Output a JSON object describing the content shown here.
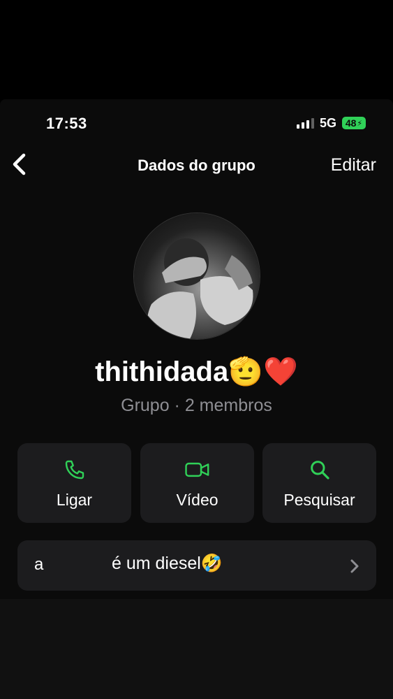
{
  "status_bar": {
    "time": "17:53",
    "network": "5G",
    "battery": "48"
  },
  "nav": {
    "title": "Dados do grupo",
    "edit_label": "Editar"
  },
  "group": {
    "name": "thithidada🫡❤️",
    "subtitle": "Grupo · 2 membros"
  },
  "actions": [
    {
      "label": "Ligar",
      "icon": "phone-icon"
    },
    {
      "label": "Vídeo",
      "icon": "video-icon"
    },
    {
      "label": "Pesquisar",
      "icon": "search-icon"
    }
  ],
  "description": {
    "prefix": "a",
    "text": "é um diesel🤣"
  },
  "colors": {
    "accent": "#30d158",
    "card": "#1c1c1e",
    "secondary_text": "#8e8e93"
  }
}
